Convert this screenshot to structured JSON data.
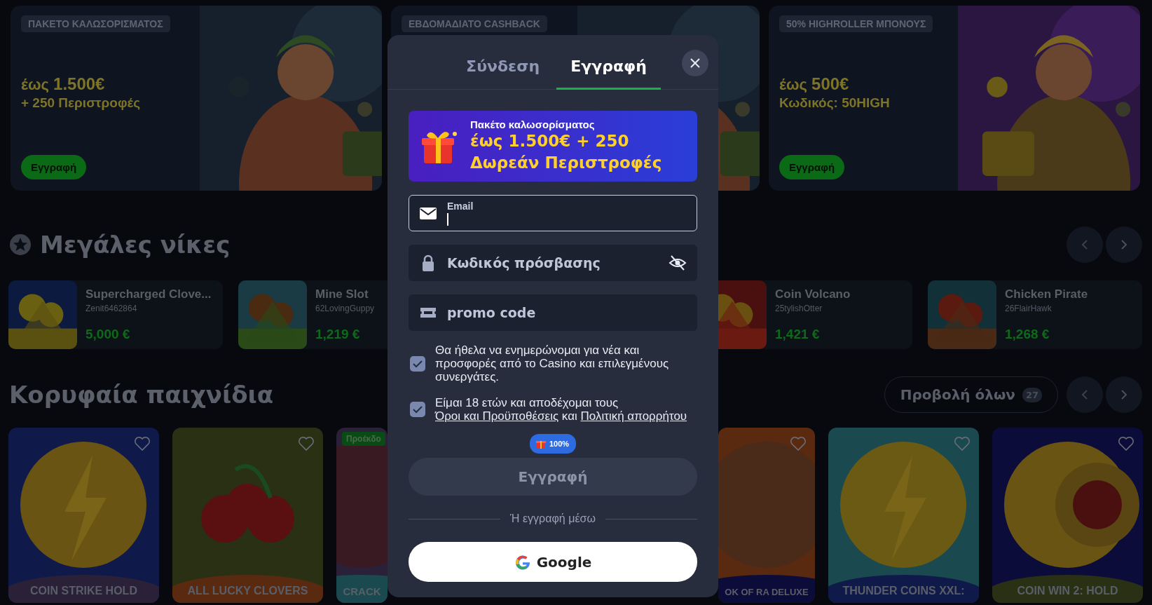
{
  "banners": [
    {
      "tag": "ΠΑΚΕΤΟ ΚΑΛΩΣΟΡΙΣΜΑΤΟΣ",
      "headline": "έως **1.500€**",
      "subline": "+ 250 Περιστροφές",
      "button": "Εγγραφή"
    },
    {
      "tag": "ΕΒΔΟΜΑΔΙΑΤΟ CASHBACK"
    },
    {
      "tag": "50% HIGHROLLER ΜΠΟΝΟΥΣ",
      "headline": "έως **500€**",
      "subline": "Κωδικός: 50HIGH",
      "button": "Εγγραφή"
    }
  ],
  "big_wins": {
    "title": "Μεγάλες νίκες",
    "items": [
      {
        "game": "Supercharged Clove...",
        "player": "Zenit6462864",
        "amount": "5,000 €"
      },
      {
        "game": "Mine Slot",
        "player": "62LovingGuppy",
        "amount": "1,219 €"
      },
      {
        "game": "Coin Volcano",
        "player": "25tylishOtter",
        "amount": "1,421 €"
      },
      {
        "game": "Chicken Pirate",
        "player": "26FlairHawk",
        "amount": "1,268 €"
      }
    ]
  },
  "top_games": {
    "title": "Κορυφαία παιχνίδια",
    "view_all": {
      "label": "Προβολή όλων",
      "count": "27"
    },
    "items": [
      {
        "title": "COIN STRIKE HOLD"
      },
      {
        "title": "ALL LUCKY CLOVERS"
      },
      {
        "title": "CRACK",
        "badge": "Προέκδο"
      },
      {
        "title": "OK OF RA DELUXE"
      },
      {
        "title": "THUNDER COINS XXL:"
      },
      {
        "title": "COIN WIN 2: HOLD"
      }
    ]
  },
  "modal": {
    "tabs": [
      {
        "label": "Σύνδεση",
        "selected": false
      },
      {
        "label": "Εγγραφή",
        "selected": true
      }
    ],
    "promo": {
      "caption": "Πακέτο καλωσορίσματος",
      "line1": "έως 1.500€ + 250",
      "line2": "Δωρεάν Περιστροφές"
    },
    "fields": [
      {
        "kind": "email",
        "label": "Email",
        "focused": true
      },
      {
        "kind": "password",
        "placeholder": "Κωδικός πρόσβασης",
        "focused": false
      },
      {
        "kind": "promo",
        "placeholder": "promo code",
        "focused": false
      }
    ],
    "consents": [
      {
        "checked": true,
        "parts": [
          {
            "text": "Θα ήθελα να ενημερώνομαι για νέα και προσφορές από το Casino και επιλεγμένους συνεργάτες."
          }
        ]
      },
      {
        "checked": true,
        "parts": [
          {
            "text": "Είμαι 18 ετών και αποδέχομαι τους "
          },
          {
            "link": "Όροι και Προϋποθέσεις"
          },
          {
            "text": " και "
          },
          {
            "link": "Πολιτική απορρήτου"
          }
        ]
      }
    ],
    "badge": "100%",
    "submit": {
      "label": "Εγγραφή",
      "disabled": true
    },
    "divider": "Ή εγγραφή μέσω",
    "social": "Google"
  }
}
